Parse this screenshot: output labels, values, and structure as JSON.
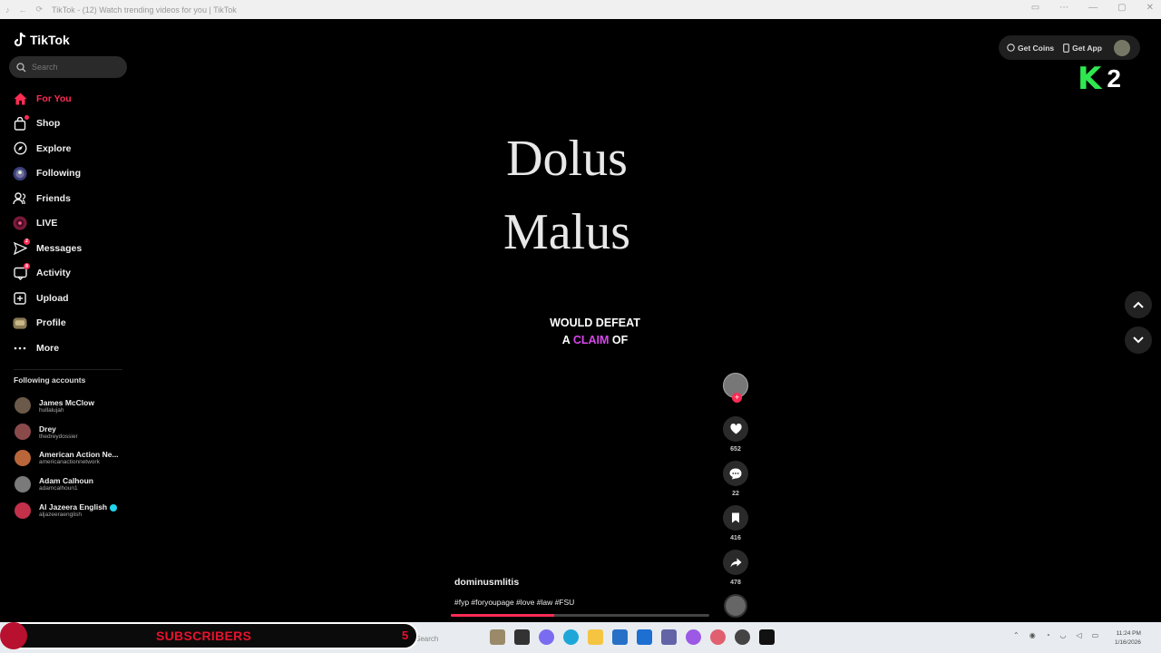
{
  "browser": {
    "tab_title": "TikTok - (12) Watch trending videos for you | TikTok"
  },
  "sidebar": {
    "logo_text": "TikTok",
    "search_placeholder": "Search",
    "items": [
      {
        "label": "For You",
        "icon": "home-icon",
        "active": true
      },
      {
        "label": "Shop",
        "icon": "shop-bag-icon",
        "badge": ""
      },
      {
        "label": "Explore",
        "icon": "compass-icon"
      },
      {
        "label": "Following",
        "icon": "following-avatar-icon"
      },
      {
        "label": "Friends",
        "icon": "friends-icon"
      },
      {
        "label": "LIVE",
        "icon": "live-icon"
      },
      {
        "label": "Messages",
        "icon": "messages-icon",
        "badge": "2"
      },
      {
        "label": "Activity",
        "icon": "activity-icon",
        "badge": "8"
      },
      {
        "label": "Upload",
        "icon": "upload-icon"
      },
      {
        "label": "Profile",
        "icon": "profile-avatar-icon"
      },
      {
        "label": "More",
        "icon": "more-dots-icon"
      }
    ],
    "following_title": "Following accounts",
    "accounts": [
      {
        "name": "James McClow",
        "username": "hullalujah"
      },
      {
        "name": "Drey",
        "username": "thedreydossier"
      },
      {
        "name": "American Action Ne...",
        "username": "americanactionnetwork"
      },
      {
        "name": "Adam Calhoun",
        "username": "adamcalhoun1"
      },
      {
        "name": "Al Jazeera English",
        "username": "aljazeeraenglish",
        "verified": true
      }
    ]
  },
  "video": {
    "title_line1": "Dolus",
    "title_line2": "Malus",
    "caption_line1": "WOULD DEFEAT",
    "caption_a": "A",
    "caption_highlight": "CLAIM",
    "caption_of": "OF",
    "author": "dominusmlitis",
    "tags": "#fyp #foryoupage #love #law #FSU",
    "progress": 0.4,
    "likes": "652",
    "comments": "22",
    "saves": "416",
    "shares": "478"
  },
  "header": {
    "get_coins": "Get Coins",
    "get_app": "Get App"
  },
  "overlay": {
    "k_logo": "K",
    "k_number": "2",
    "subscribers_label": "SUBSCRIBERS",
    "subscribers_count": "5"
  },
  "taskbar": {
    "search_text": "Search",
    "time": "11:24 PM",
    "date": "1/16/2026"
  },
  "colors": {
    "accent": "#fe2c55",
    "caption_highlight": "#d946ef",
    "k_green": "#2ee84f",
    "subs_red": "#e8112d"
  }
}
